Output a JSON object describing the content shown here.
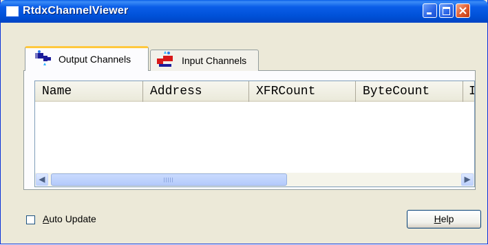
{
  "window": {
    "title": "RtdxChannelViewer"
  },
  "title_buttons": [
    "minimize-icon",
    "maximize-icon",
    "close-icon"
  ],
  "tabs": [
    {
      "label": "Output Channels",
      "icon": "output-channel-icon",
      "selected": true
    },
    {
      "label": "Input Channels",
      "icon": "input-channel-icon",
      "selected": false
    }
  ],
  "listview": {
    "columns": [
      "Name",
      "Address",
      "XFRCount",
      "ByteCount",
      "I"
    ],
    "rows": []
  },
  "footer": {
    "auto_update": {
      "label_prefix": "",
      "label_mnemonic": "A",
      "label_rest": "uto Update",
      "checked": false
    },
    "help_button": {
      "label_mnemonic": "H",
      "label_rest": "elp"
    }
  },
  "scrollbar": {
    "left_arrow": "◀",
    "right_arrow": "▶"
  },
  "colors": {
    "titlebar": "#0a5ee8",
    "tab_highlight": "#ffc83c"
  }
}
